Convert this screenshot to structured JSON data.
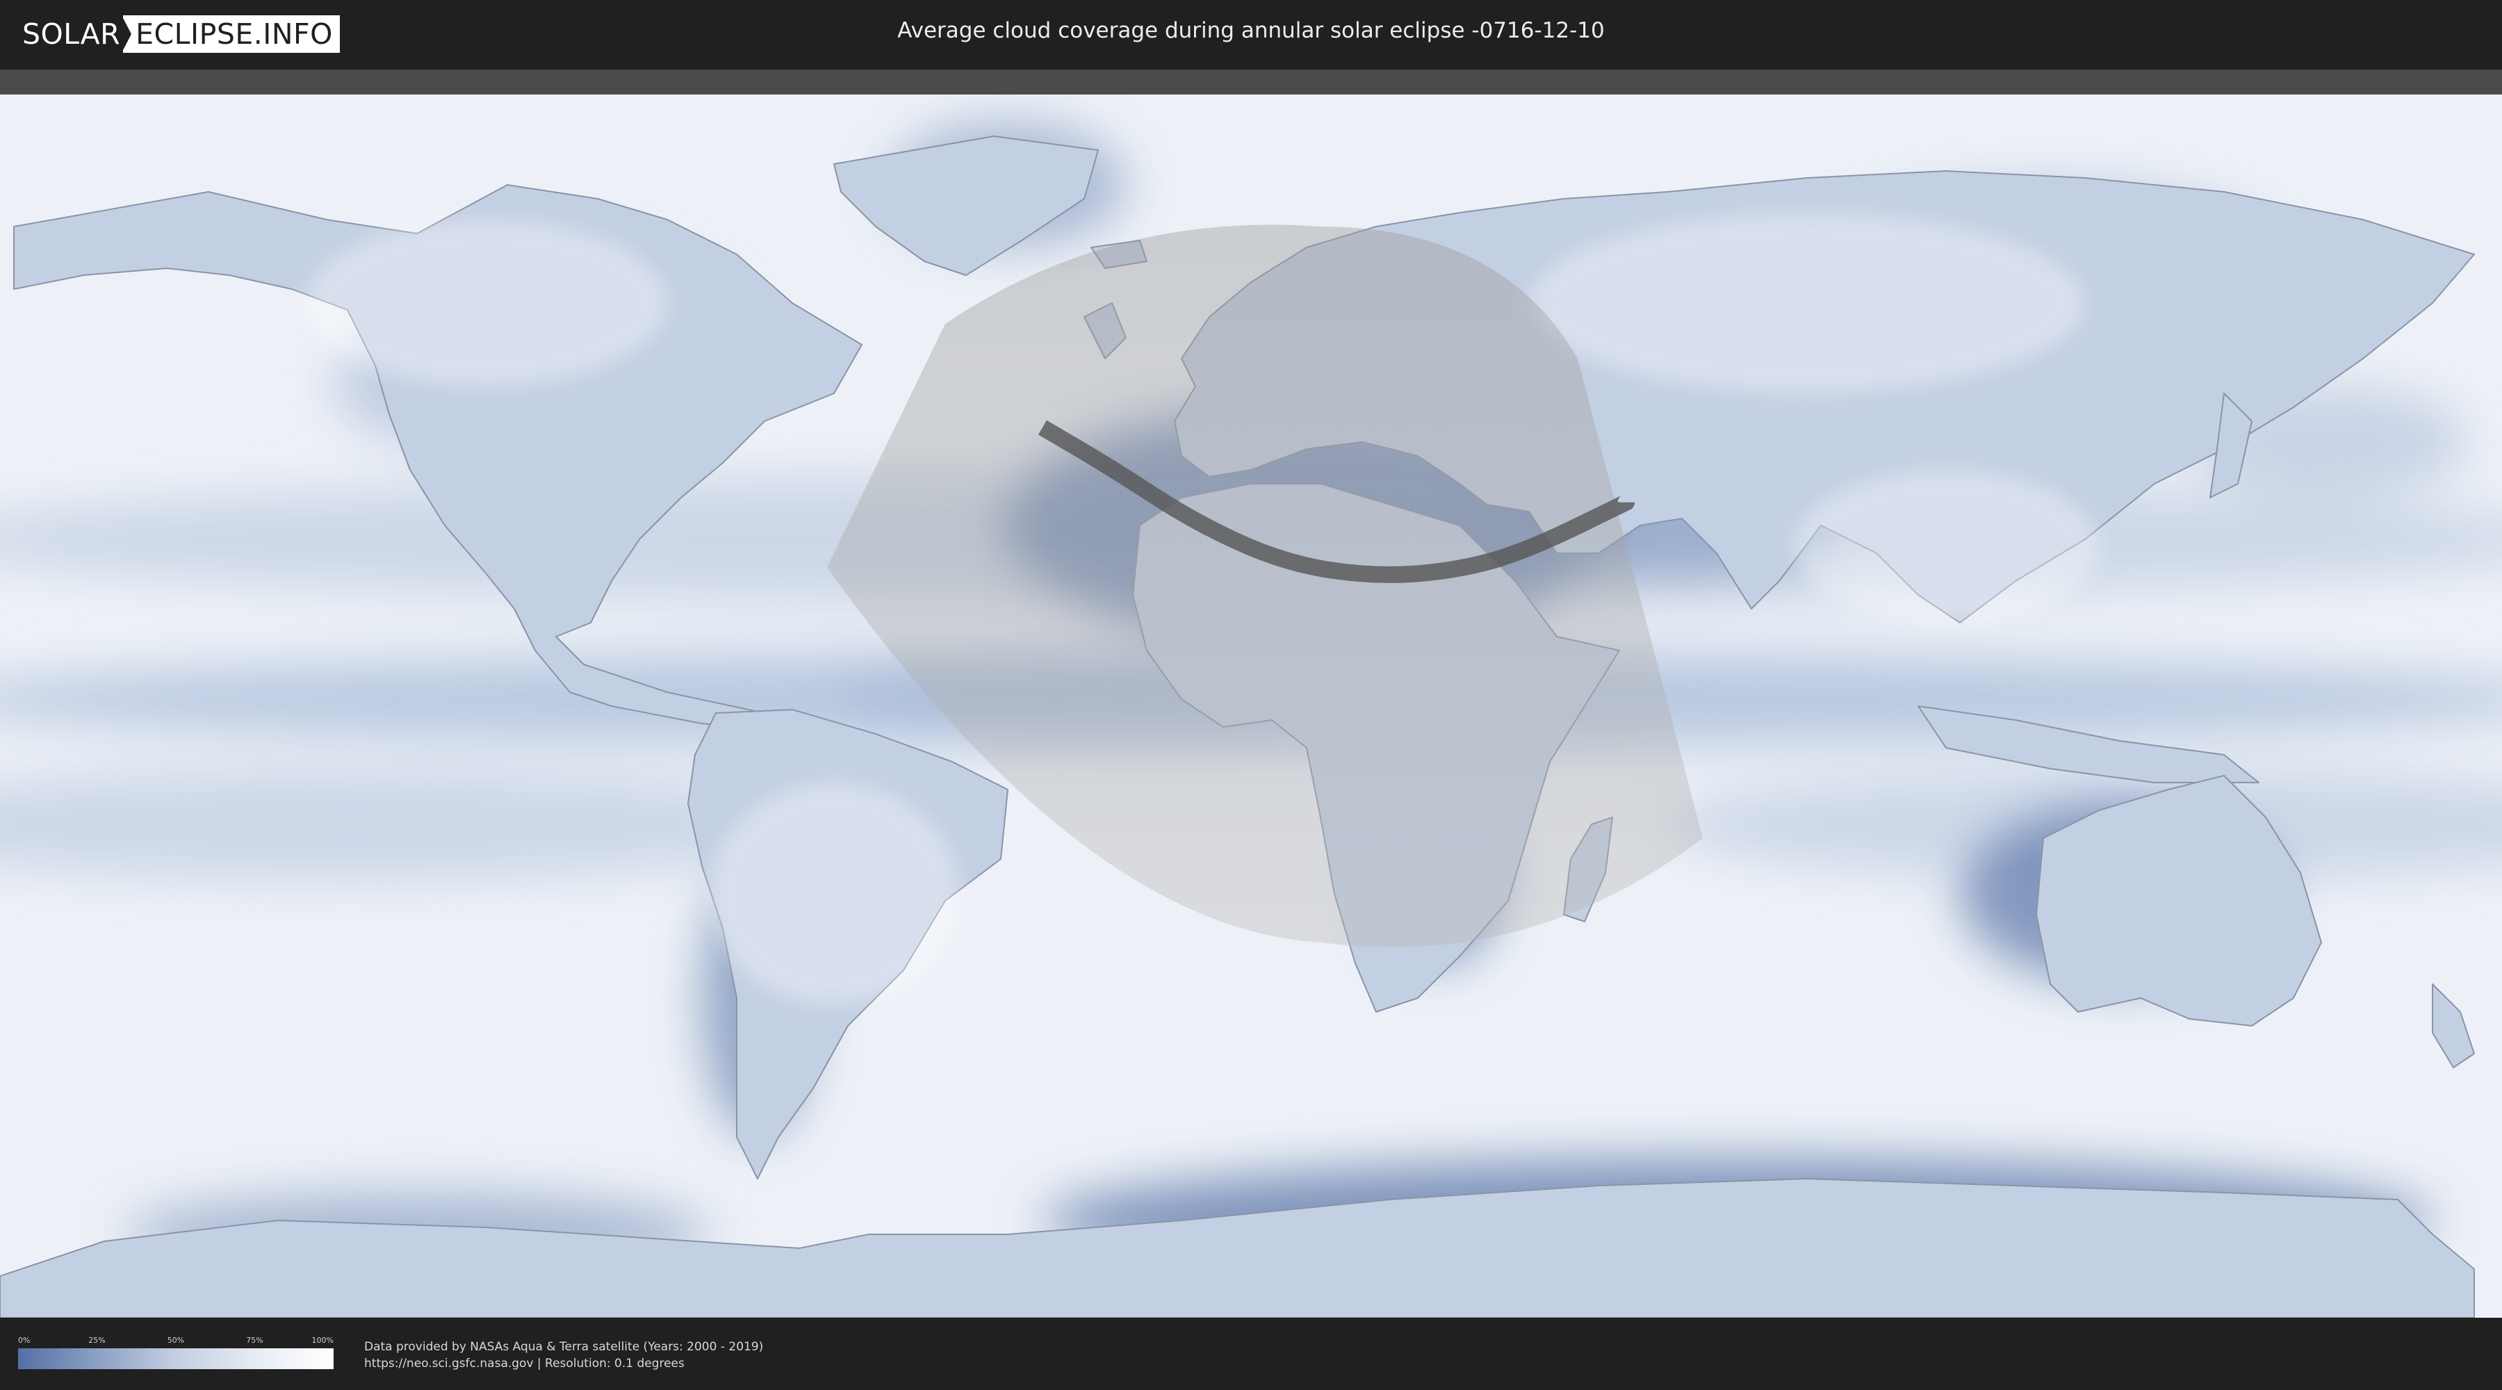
{
  "header": {
    "logo": {
      "part1": "SOLAR",
      "part2": "ECLIPSE.INFO"
    },
    "title": "Average cloud coverage during annular solar eclipse -0716-12-10"
  },
  "map": {
    "type": "equirectangular-world",
    "layers": [
      "cloud-coverage",
      "eclipse-visibility-zone",
      "annularity-path"
    ],
    "path_of_annularity": [
      [
        -30,
        41
      ],
      [
        -20,
        35
      ],
      [
        -8,
        27
      ],
      [
        5,
        21
      ],
      [
        18,
        19
      ],
      [
        30,
        20
      ],
      [
        40,
        23
      ],
      [
        54,
        30
      ]
    ],
    "colors": {
      "cloud_low": "#5470a4",
      "cloud_high": "#ffffff",
      "land_border": "#8a94a6",
      "path": "#5a5a5a",
      "visibility_zone": "#b3b3b3"
    }
  },
  "legend": {
    "ticks": [
      "0%",
      "25%",
      "50%",
      "75%",
      "100%"
    ],
    "gradient": [
      "#5470a4",
      "#8ba0c4",
      "#c4cfe2",
      "#e6ebf3",
      "#ffffff"
    ]
  },
  "credits": {
    "line1": "Data provided by NASAs Aqua & Terra satellite (Years: 2000 - 2019)",
    "line2": "https://neo.sci.gsfc.nasa.gov | Resolution: 0.1 degrees"
  }
}
